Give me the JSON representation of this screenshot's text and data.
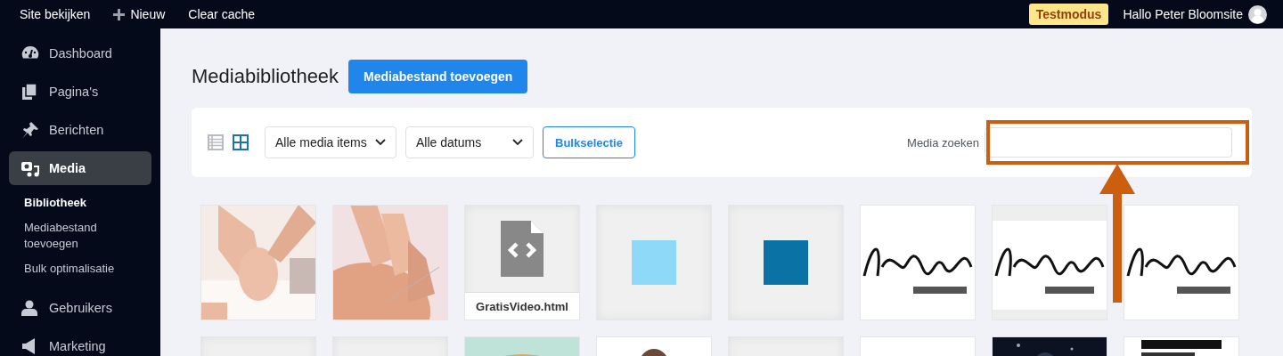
{
  "top_bar": {
    "items": [
      {
        "kind": "link",
        "label": "Site bekijken"
      },
      {
        "kind": "new",
        "label": "Nieuw"
      },
      {
        "kind": "link",
        "label": "Clear cache"
      }
    ],
    "badge": "Testmodus",
    "greeting": "Hallo Peter Bloomsite"
  },
  "sidebar": {
    "items": [
      {
        "label": "Dashboard",
        "selected": false
      },
      {
        "label": "Pagina's",
        "selected": false
      },
      {
        "label": "Berichten",
        "selected": false
      },
      {
        "label": "Media",
        "selected": true,
        "children": [
          {
            "label": "Bibliotheek",
            "selected": true
          },
          {
            "label": "Mediabestand toevoegen",
            "selected": false
          },
          {
            "label": "Bulk optimalisatie",
            "selected": false
          }
        ]
      },
      {
        "label": "Gebruikers",
        "selected": false
      },
      {
        "label": "Marketing",
        "selected": false
      }
    ]
  },
  "page": {
    "title": "Mediabibliotheek",
    "add_button": "Mediabestand toevoegen"
  },
  "toolbar": {
    "views": [
      {
        "kind": "list",
        "selected": false
      },
      {
        "kind": "grid",
        "selected": true
      }
    ],
    "filters": [
      "Alle media items",
      "Alle datums"
    ],
    "bulk_button": "Bulkselectie",
    "search": {
      "label": "Media zoeken"
    }
  },
  "media": [
    {
      "kind": "picture"
    },
    {
      "kind": "picture"
    },
    {
      "kind": "file",
      "caption": "GratisVideo.html"
    },
    {
      "kind": "swatch",
      "color": "#8ed8f8"
    },
    {
      "kind": "swatch",
      "color": "#0a72a5"
    },
    {
      "kind": "picture"
    },
    {
      "kind": "picture"
    },
    {
      "kind": "picture"
    },
    {
      "kind": "blank"
    },
    {
      "kind": "blank"
    },
    {
      "kind": "picture"
    },
    {
      "kind": "picture"
    },
    {
      "kind": "blank"
    },
    {
      "kind": "picture"
    },
    {
      "kind": "picture"
    },
    {
      "kind": "picture"
    }
  ],
  "annotation": {
    "frame": true,
    "arrow": true
  }
}
